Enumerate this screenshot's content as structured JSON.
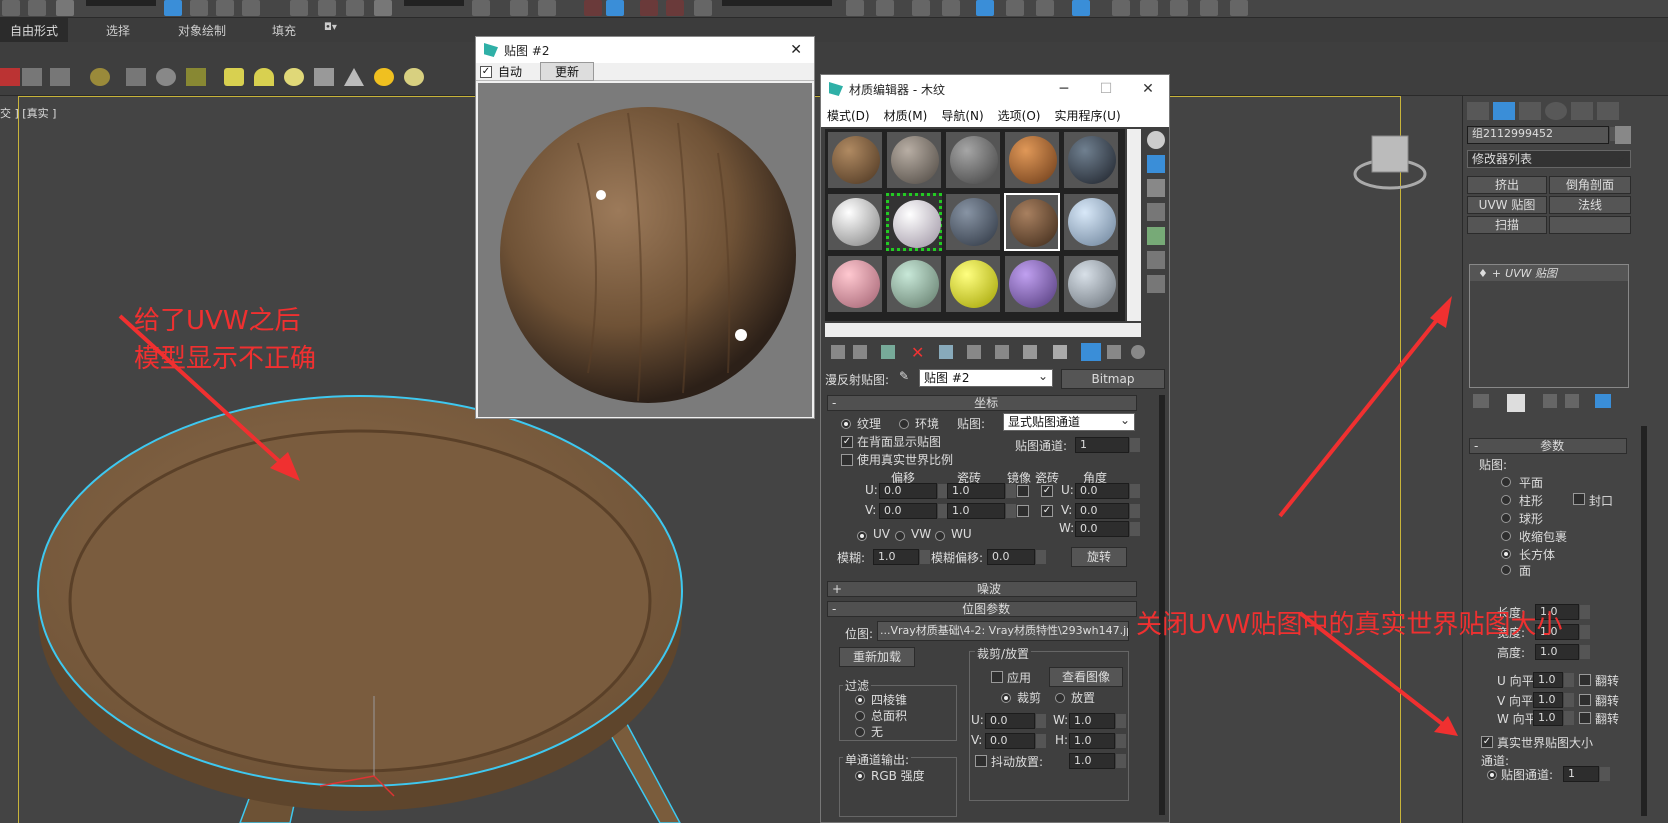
{
  "ribbon": {
    "tabs": [
      "自由形式",
      "选择",
      "对象绘制",
      "填充"
    ]
  },
  "viewport": {
    "label": "交 ] [真实 ]"
  },
  "map_window": {
    "title": "贴图 #2",
    "auto_label": "自动",
    "update_btn": "更新",
    "auto_checked": true,
    "close": "✕"
  },
  "mat_editor": {
    "title": "材质编辑器 - 木纹",
    "min": "─",
    "max": "☐",
    "close": "✕",
    "menu": [
      "模式(D)",
      "材质(M)",
      "导航(N)",
      "选项(O)",
      "实用程序(U)"
    ],
    "diffuse_label": "漫反射贴图:",
    "map_name": "贴图 #2",
    "map_type": "Bitmap",
    "coords": {
      "header": "坐标",
      "texture": "纹理",
      "environ": "环境",
      "mapping_label": "贴图:",
      "mapping_value": "显式贴图通道",
      "show_back": "在背面显示贴图",
      "real_world": "使用真实世界比例",
      "channel_label": "贴图通道:",
      "channel_value": "1",
      "offset": "偏移",
      "tiling": "瓷砖",
      "mirror": "镜像",
      "tile": "瓷砖",
      "angle": "角度",
      "u": "U:",
      "v": "V:",
      "w": "W:",
      "u_offset": "0.0",
      "v_offset": "0.0",
      "u_tiling": "1.0",
      "v_tiling": "1.0",
      "u_angle": "0.0",
      "v_angle": "0.0",
      "w_angle": "0.0",
      "uv": "UV",
      "vw": "VW",
      "wu": "WU",
      "blur_label": "模糊:",
      "blur": "1.0",
      "blur_offset_label": "模糊偏移:",
      "blur_offset": "0.0",
      "rotate": "旋转"
    },
    "noise_header": "噪波",
    "bitmap": {
      "header": "位图参数",
      "path_label": "位图:",
      "path": "...Vray材质基础\\4-2: Vray材质特性\\293wh147.jpg",
      "reload": "重新加载",
      "crop_header": "裁剪/放置",
      "apply": "应用",
      "view_image": "查看图像",
      "crop": "裁剪",
      "place": "放置",
      "filter": "过滤",
      "pyramidal": "四棱锥",
      "summed": "总面积",
      "none": "无",
      "u": "U:",
      "v": "V:",
      "w": "W:",
      "h": "H:",
      "u_val": "0.0",
      "v_val": "0.0",
      "w_val": "1.0",
      "h_val": "1.0",
      "jitter": "抖动放置:",
      "jitter_val": "1.0",
      "mono_output": "单通道输出:",
      "rgb": "RGB 强度"
    }
  },
  "cmd_panel": {
    "object_name": "组2112999452",
    "modifier_list": "修改器列表",
    "mod_buttons": [
      "挤出",
      "倒角剖面",
      "UVW 贴图",
      "法线",
      "扫描",
      ""
    ],
    "stack_item": "UVW 贴图",
    "params_header": "参数",
    "mapping_label": "贴图:",
    "mapping_types": [
      "平面",
      "柱形",
      "球形",
      "收缩包裹",
      "长方体",
      "面"
    ],
    "cap": "封口",
    "length_label": "长度:",
    "length": "1.0",
    "width_label": "宽度:",
    "width": "1.0",
    "height_label": "高度:",
    "height": "1.0",
    "u_tile": "U 向平",
    "v_tile": "V 向平",
    "w_tile": "W 向平",
    "tile_val": "1.0",
    "flip": "翻转",
    "real_world": "真实世界贴图大小",
    "channel_header": "通道:",
    "map_channel": "贴图通道:",
    "map_channel_val": "1"
  },
  "annotations": {
    "a1_line1": "给了UVW之后",
    "a1_line2": "模型显示不正确",
    "a2": "关闭UVW贴图中的真实世界贴图大小"
  },
  "colors": {
    "annotation": "#f03030",
    "selection": "#3ec8f0",
    "accent": "#3a8ed8"
  }
}
